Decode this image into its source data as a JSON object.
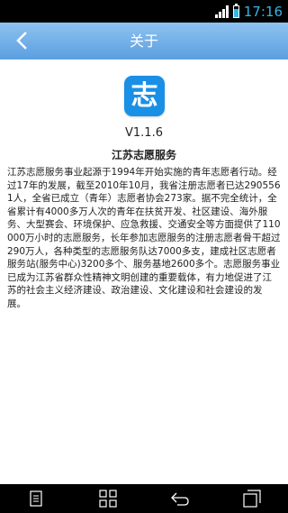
{
  "status_bar": {
    "time": "17:16",
    "signal_icon": "signal-icon",
    "battery_icon": "battery-icon"
  },
  "header": {
    "title": "关于",
    "back_icon": "back-arrow-icon"
  },
  "about": {
    "logo_char": "志",
    "version": "V1.1.6",
    "app_name": "江苏志愿服务",
    "description": "江苏志愿服务事业起源于1994年开始实施的青年志愿者行动。经过17年的发展，截至2010年10月，我省注册志愿者已达2905561人，全省已成立（青年）志愿者协会273家。据不完全统计，全省累计有4000多万人次的青年在扶贫开发、社区建设、海外服务、大型赛会、环境保护、应急救援、交通安全等方面提供了110000万小时的志愿服务，长年参加志愿服务的注册志愿者骨干超过290万人，各种类型的志愿服务队达7000多支，建成社区志愿者服务站(服务中心)3200多个、服务基地2600多个。志愿服务事业已成为江苏省群众性精神文明创建的重要载体，有力地促进了江苏的社会主义经济建设、政治建设、文化建设和社会建设的发展。"
  },
  "nav_bar": {
    "icons": [
      "menu-icon",
      "home-icon",
      "back-icon",
      "recent-apps-icon"
    ]
  },
  "colors": {
    "title_bar": "#5b9fe0",
    "logo": "#1a8fe6",
    "status_accent": "#33b5e5"
  }
}
